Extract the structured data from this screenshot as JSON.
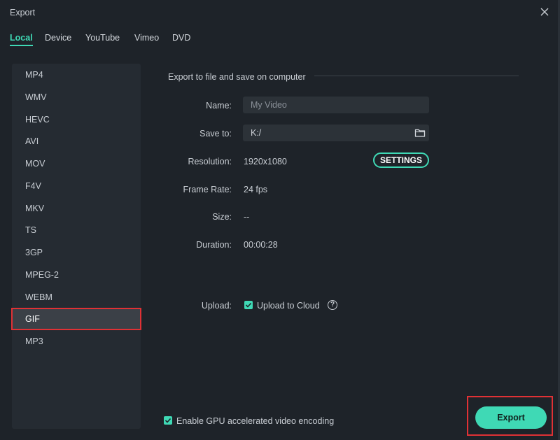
{
  "window": {
    "title": "Export"
  },
  "tabs": [
    "Local",
    "Device",
    "YouTube",
    "Vimeo",
    "DVD"
  ],
  "formats": [
    "MP4",
    "WMV",
    "HEVC",
    "AVI",
    "MOV",
    "F4V",
    "MKV",
    "TS",
    "3GP",
    "MPEG-2",
    "WEBM",
    "GIF",
    "MP3"
  ],
  "selected_format": "GIF",
  "panel": {
    "section_title": "Export to file and save on computer",
    "name_label": "Name:",
    "name_placeholder": "My Video",
    "save_to_label": "Save to:",
    "save_to_value": "K:/",
    "resolution_label": "Resolution:",
    "resolution_value": "1920x1080",
    "settings_label": "SETTINGS",
    "frame_rate_label": "Frame Rate:",
    "frame_rate_value": "24 fps",
    "size_label": "Size:",
    "size_value": "--",
    "duration_label": "Duration:",
    "duration_value": "00:00:28",
    "upload_label": "Upload:",
    "upload_option": "Upload to Cloud",
    "help_glyph": "?"
  },
  "footer": {
    "gpu_label": "Enable GPU accelerated video encoding",
    "export_label": "Export"
  },
  "colors": {
    "accent": "#3fd9b5",
    "highlight_border": "#e03135",
    "background": "#1e2329",
    "sidebar": "#252b32",
    "selected_row": "#3b4047"
  },
  "icons": {
    "close": "close-icon",
    "folder": "folder-icon",
    "help": "help-icon",
    "check": "checkmark-icon"
  }
}
